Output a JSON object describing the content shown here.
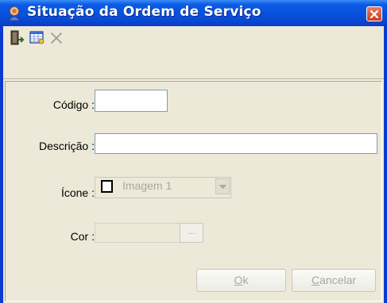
{
  "window": {
    "title": "Situação da Ordem de Serviço"
  },
  "toolbar": {
    "icons": [
      "exit-door-icon",
      "view-grid-icon",
      "delete-x-icon"
    ]
  },
  "form": {
    "codigo_label": "Código :",
    "codigo_value": "",
    "descricao_label": "Descrição :",
    "descricao_value": "",
    "icone_label": "Ícone :",
    "icone_value": "Imagem 1",
    "cor_label": "Cor :",
    "cor_button": "..."
  },
  "buttons": {
    "ok_first": "O",
    "ok_rest": "k",
    "cancel_first": "C",
    "cancel_rest": "ancelar"
  },
  "colors": {
    "title_bar": "#0a5ae6",
    "window_bg": "#ece9d8",
    "close_button": "#c8401f"
  }
}
